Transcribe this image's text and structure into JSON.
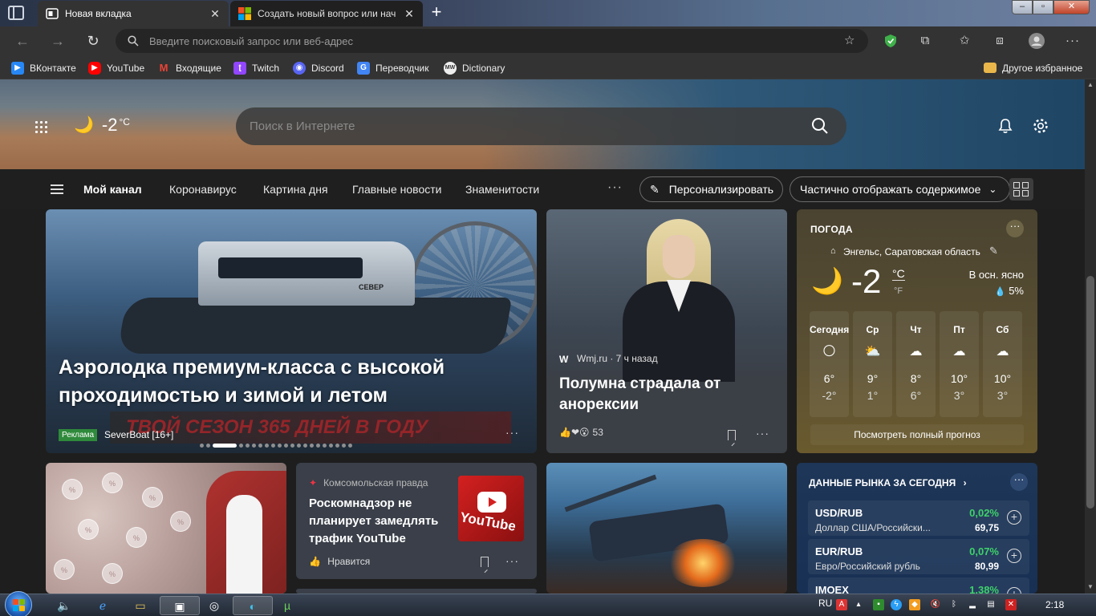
{
  "browser": {
    "tabs": [
      {
        "title": "Новая вкладка",
        "active": true
      },
      {
        "title": "Создать новый вопрос или нач",
        "active": false
      }
    ],
    "address_placeholder": "Введите поисковый запрос или веб-адрес",
    "favorites": [
      {
        "label": "ВКонтакте",
        "icon": "vk-icon",
        "color": "#2787f5"
      },
      {
        "label": "YouTube",
        "icon": "youtube-icon",
        "color": "#ff0000"
      },
      {
        "label": "Входящие",
        "icon": "gmail-icon",
        "color": "#ea4335"
      },
      {
        "label": "Twitch",
        "icon": "twitch-icon",
        "color": "#9146ff"
      },
      {
        "label": "Discord",
        "icon": "discord-icon",
        "color": "#5865f2"
      },
      {
        "label": "Переводчик",
        "icon": "translate-icon",
        "color": "#4285f4"
      },
      {
        "label": "Dictionary",
        "icon": "dictionary-icon",
        "color": "#eeeeee"
      }
    ],
    "other_favorites": "Другое избранное"
  },
  "hero": {
    "temp": "-2",
    "unit": "°C",
    "search_placeholder": "Поиск в Интернете"
  },
  "feed_nav": {
    "tabs": [
      "Мой канал",
      "Коронавирус",
      "Картина дня",
      "Главные новости",
      "Знаменитости"
    ],
    "personalize": "Персонализировать",
    "display_mode": "Частично отображать содержимое"
  },
  "main_card": {
    "title": "Аэролодка премиум-класса с высокой проходимостью и зимой и летом",
    "ad_label": "Реклама",
    "source": "SeverBoat [16+]",
    "banner_text": "ТВОЙ СЕЗОН 365 ДНЕЙ В ГОДУ",
    "boat_brand": "СЕВЕР"
  },
  "luna_card": {
    "source": "Wmj.ru · 7 ч назад",
    "title": "Полумна страдала от анорексии",
    "reactions_count": "53"
  },
  "weather_card": {
    "title": "ПОГОДА",
    "location": "Энгельс, Саратовская область",
    "temp": "-2",
    "unit_c": "°C",
    "unit_f": "°F",
    "condition": "В осн. ясно",
    "precip": "5%",
    "forecast": [
      {
        "day": "Сегодня",
        "icon": "sun-icon",
        "hi": "6°",
        "lo": "-2°"
      },
      {
        "day": "Ср",
        "icon": "partly-cloudy-icon",
        "hi": "9°",
        "lo": "1°"
      },
      {
        "day": "Чт",
        "icon": "cloud-icon",
        "hi": "8°",
        "lo": "6°"
      },
      {
        "day": "Пт",
        "icon": "cloud-icon",
        "hi": "10°",
        "lo": "3°"
      },
      {
        "day": "Сб",
        "icon": "cloud-icon",
        "hi": "10°",
        "lo": "3°"
      }
    ],
    "full_forecast_link": "Посмотреть полный прогноз"
  },
  "news_card": {
    "source": "Комсомольская правда",
    "title": "Роскомнадзор не планирует замедлять трафик YouTube",
    "like_label": "Нравится",
    "thumb_text": "YouTube"
  },
  "market_card": {
    "title": "ДАННЫЕ РЫНКА ЗА СЕГОДНЯ",
    "rows": [
      {
        "symbol": "USD/RUB",
        "name": "Доллар США/Российски...",
        "change": "0,02%",
        "value": "69,75"
      },
      {
        "symbol": "EUR/RUB",
        "name": "Евро/Российский рубль",
        "change": "0,07%",
        "value": "80,99"
      },
      {
        "symbol": "IMOEX",
        "name": "",
        "change": "1,38%",
        "value": ""
      }
    ]
  },
  "taskbar": {
    "lang": "RU",
    "clock": "2:18"
  },
  "colors": {
    "accent_green": "#3ed26a",
    "ad_green": "#2f8a3b",
    "weather_bg": "#5a4f32",
    "market_bg": "#1e3657"
  }
}
